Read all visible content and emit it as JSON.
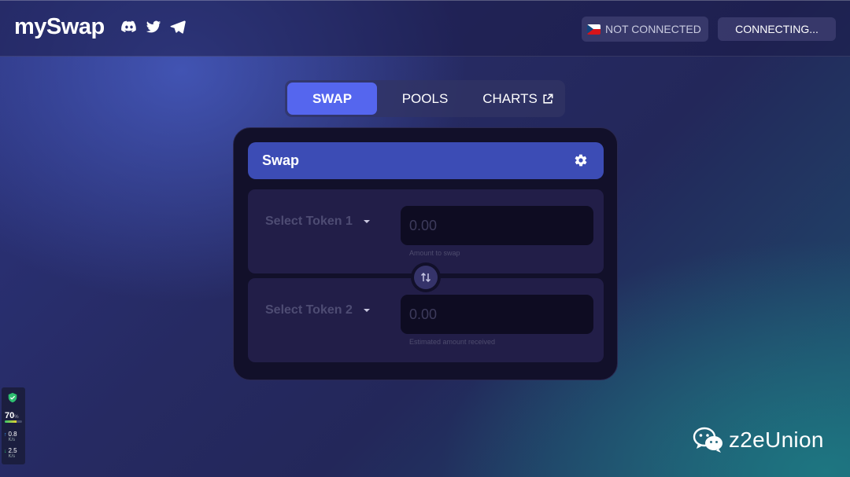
{
  "header": {
    "logo": "mySwap",
    "social": [
      "discord-icon",
      "twitter-icon",
      "telegram-icon"
    ],
    "network_label": "NOT CONNECTED",
    "connect_label": "CONNECTING..."
  },
  "tabs": [
    {
      "label": "SWAP",
      "active": true
    },
    {
      "label": "POOLS",
      "active": false
    },
    {
      "label": "CHARTS",
      "active": false,
      "icon": "external-link-icon"
    }
  ],
  "swap_card": {
    "title": "Swap",
    "settings_icon": "gear-icon",
    "from": {
      "token_label": "Select Token 1",
      "amount_placeholder": "0.00",
      "hint": "Amount to swap"
    },
    "to": {
      "token_label": "Select Token 2",
      "amount_placeholder": "0.00",
      "hint": "Estimated amount received"
    },
    "switch_icon": "swap-arrows-icon"
  },
  "system_monitor": {
    "percent": "70",
    "percent_unit": "%",
    "percent_fill": 0.7,
    "upload": "0.8",
    "upload_unit": "K/s",
    "download": "2.5",
    "download_unit": "K/s"
  },
  "watermark": {
    "text": "z2eUnion",
    "icon": "wechat-icon"
  },
  "colors": {
    "accent": "#5566ee",
    "card_header": "#3c4cb5",
    "card_bg": "#12102a",
    "panel_bg": "#221e48"
  }
}
